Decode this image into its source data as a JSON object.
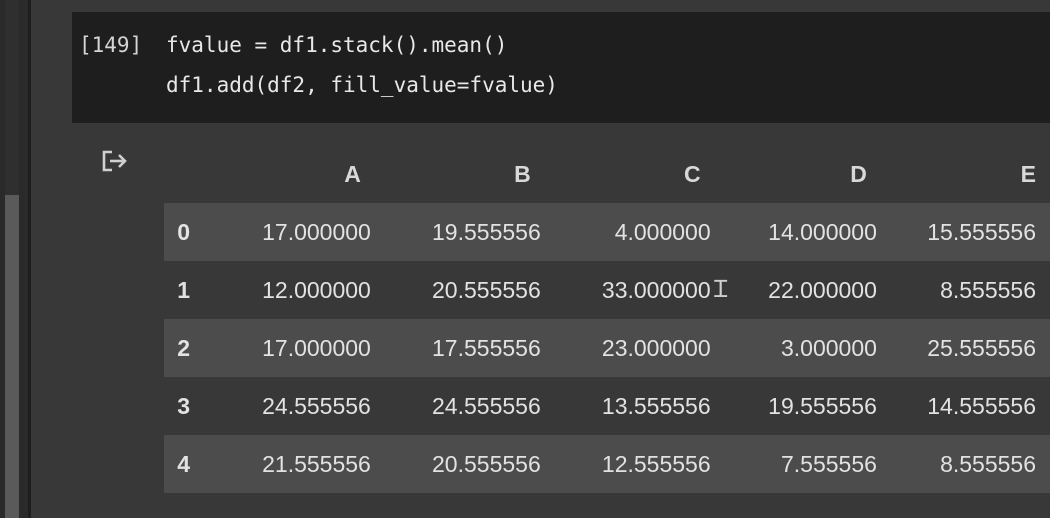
{
  "cell": {
    "execution_count": "[149]",
    "code_lines": [
      "fvalue = df1.stack().mean()",
      "df1.add(df2, fill_value=fvalue)"
    ]
  },
  "output": {
    "icon": "output-redirect-icon",
    "table": {
      "columns": [
        "A",
        "B",
        "C",
        "D",
        "E"
      ],
      "rows": [
        {
          "index": "0",
          "values": [
            "17.000000",
            "19.555556",
            "4.000000",
            "14.000000",
            "15.555556"
          ]
        },
        {
          "index": "1",
          "values": [
            "12.000000",
            "20.555556",
            "33.000000",
            "22.000000",
            "8.555556"
          ]
        },
        {
          "index": "2",
          "values": [
            "17.000000",
            "17.555556",
            "23.000000",
            "3.000000",
            "25.555556"
          ]
        },
        {
          "index": "3",
          "values": [
            "24.555556",
            "24.555556",
            "13.555556",
            "19.555556",
            "14.555556"
          ]
        },
        {
          "index": "4",
          "values": [
            "21.555556",
            "20.555556",
            "12.555556",
            "7.555556",
            "8.555556"
          ]
        }
      ]
    }
  },
  "colors": {
    "background": "#383838",
    "code_cell_bg": "#1e1e1e",
    "striped_row": "#4c4c4c"
  }
}
